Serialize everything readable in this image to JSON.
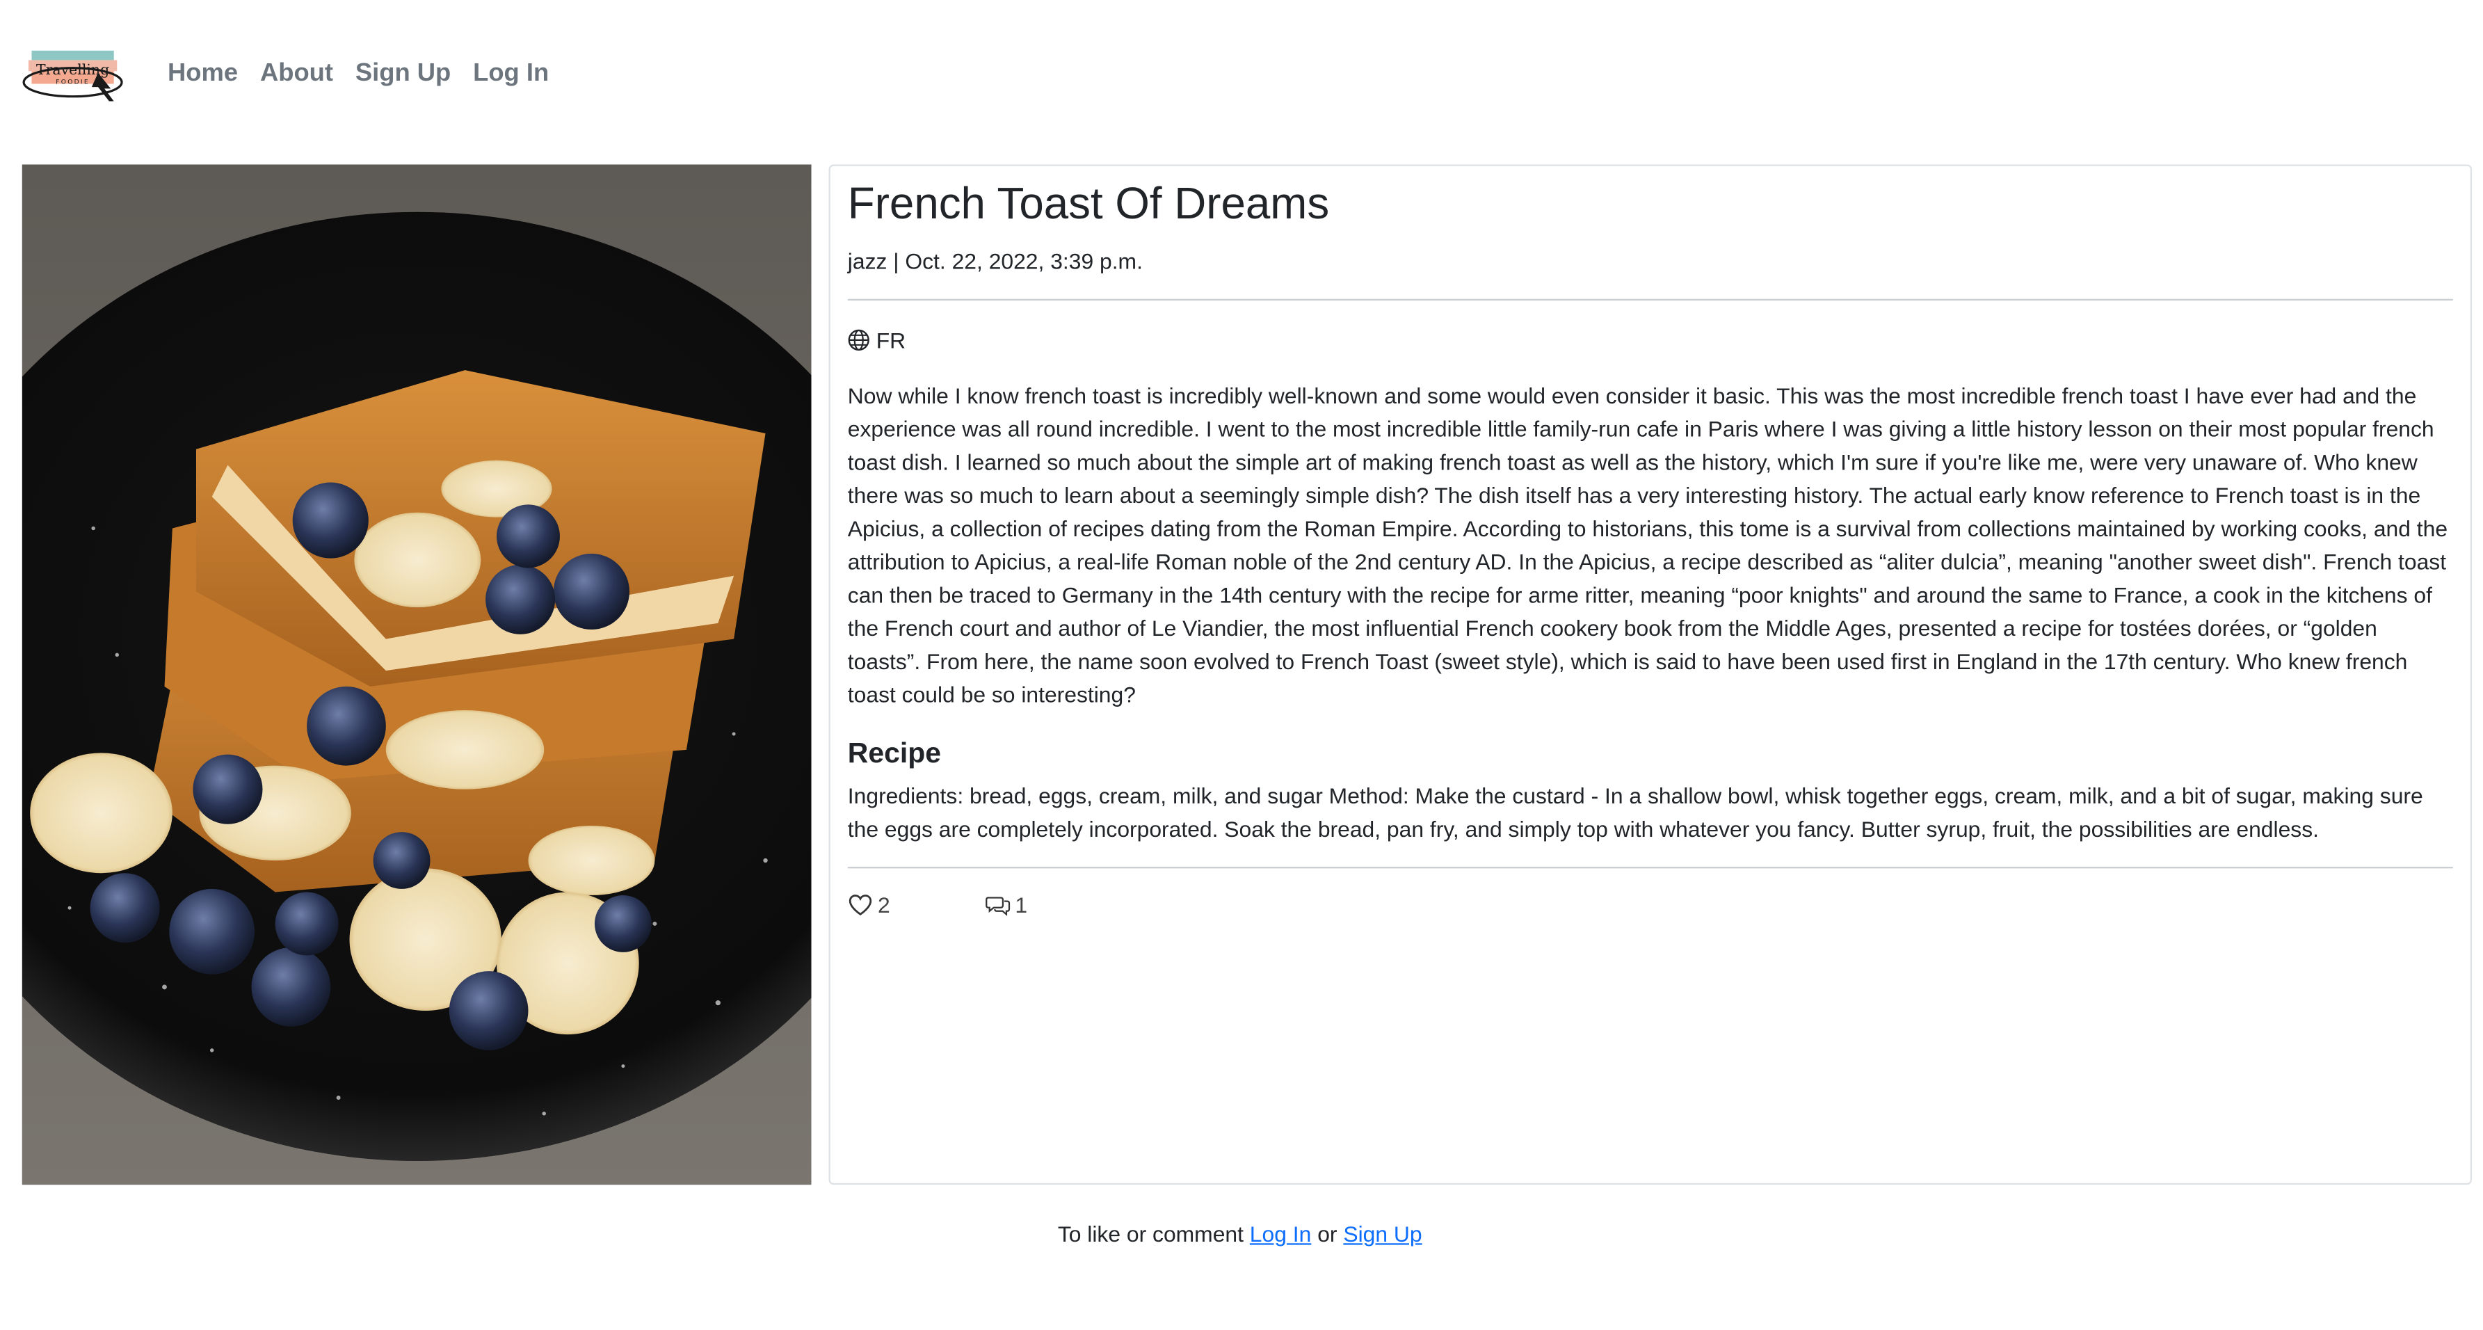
{
  "brand": {
    "logo_text_top": "Travelling",
    "logo_text_bottom": "FOODIE"
  },
  "nav": {
    "links": [
      "Home",
      "About",
      "Sign Up",
      "Log In"
    ]
  },
  "post": {
    "title": "French Toast Of Dreams",
    "meta": "jazz | Oct. 22, 2022, 3:39 p.m.",
    "country_code": "FR",
    "body": "Now while I know french toast is incredibly well-known and some would even consider it basic. This was the most incredible french toast I have ever had and the experience was all round incredible. I went to the most incredible little family-run cafe in Paris where I was giving a little history lesson on their most popular french toast dish. I learned so much about the simple art of making french toast as well as the history, which I'm sure if you're like me, were very unaware of. Who knew there was so much to learn about a seemingly simple dish? The dish itself has a very interesting history. The actual early know reference to French toast is in the Apicius, a collection of recipes dating from the Roman Empire. According to historians, this tome is a survival from collections maintained by working cooks, and the attribution to Apicius, a real-life Roman noble of the 2nd century AD. In the Apicius, a recipe described as “aliter dulcia”, meaning \"another sweet dish\". French toast can then be traced to Germany in the 14th century with the recipe for arme ritter, meaning “poor knights\" and around the same to France, a cook in the kitchens of the French court and author of Le Viandier, the most influential French cookery book from the Middle Ages, presented a recipe for tostées dorées, or “golden toasts”. From here, the name soon evolved to French Toast (sweet style), which is said to have been used first in England in the 17th century. Who knew french toast could be so interesting?",
    "recipe_heading": "Recipe",
    "recipe_text": "Ingredients: bread, eggs, cream, milk, and sugar Method: Make the custard - In a shallow bowl, whisk together eggs, cream, milk, and a bit of sugar, making sure the eggs are completely incorporated. Soak the bread, pan fry, and simply top with whatever you fancy. Butter syrup, fruit, the possibilities are endless.",
    "likes": "2",
    "comments": "1"
  },
  "footer": {
    "prompt_prefix": "To like or comment",
    "login_label": "Log In",
    "or_label": "or",
    "signup_label": "Sign Up"
  },
  "icons": {
    "globe": "globe-icon",
    "like": "heart-icon",
    "comment": "comments-icon"
  },
  "colors": {
    "link": "#0d6efd",
    "nav_text": "#6c757d"
  }
}
